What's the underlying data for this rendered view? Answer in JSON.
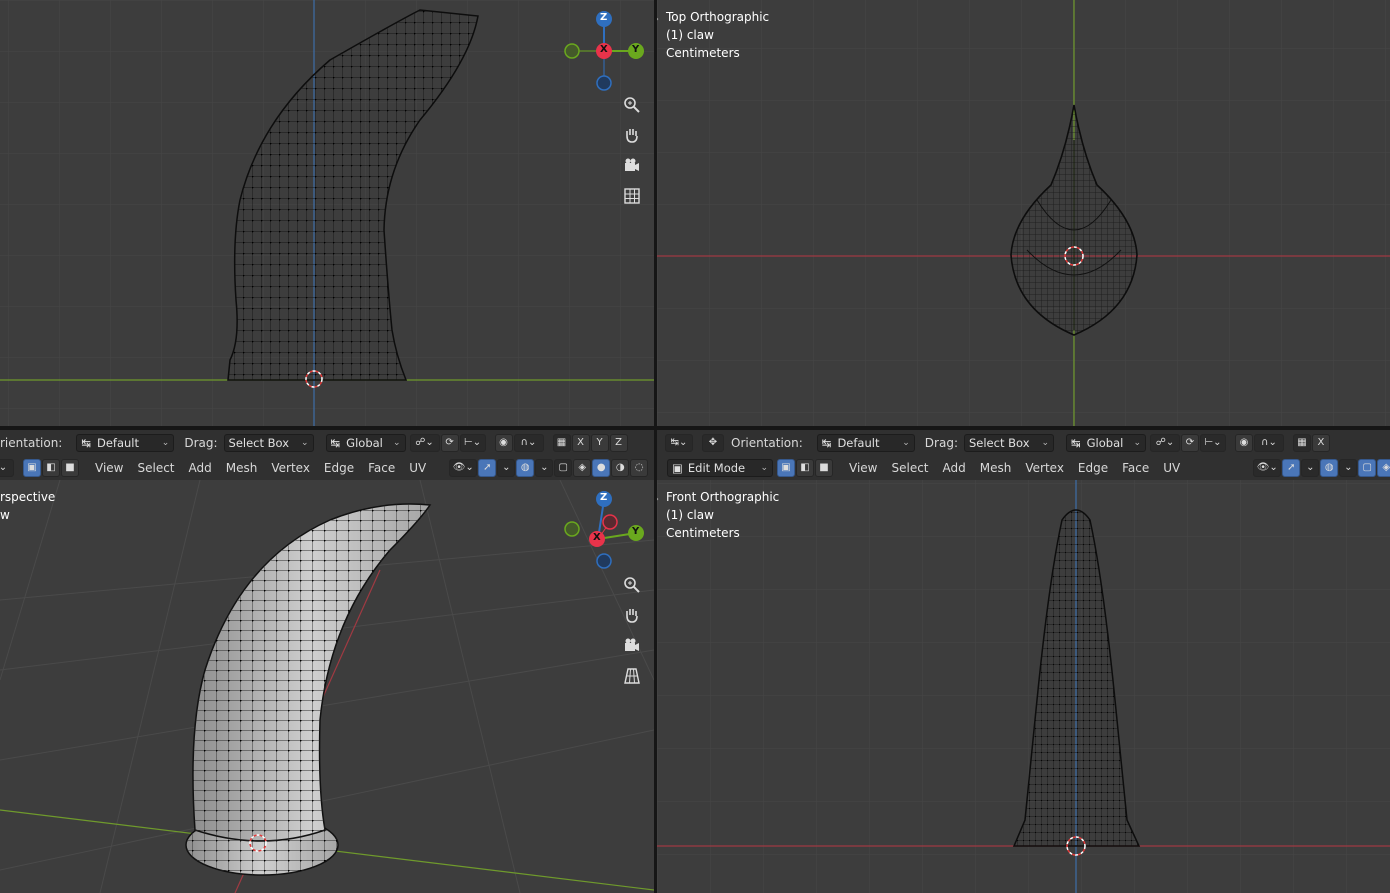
{
  "viewports": {
    "top_left": {
      "title": "",
      "object": "",
      "units": ""
    },
    "top_right": {
      "title": "Top Orthographic",
      "object": "(1) claw",
      "units": "Centimeters"
    },
    "bottom_left": {
      "title": "rspective",
      "object": "w",
      "units": ""
    },
    "bottom_right": {
      "title": "Front Orthographic",
      "object": "(1) claw",
      "units": "Centimeters"
    }
  },
  "gizmo_axes": {
    "x": "X",
    "y": "Y",
    "z": "Z"
  },
  "header_left": {
    "orientation_label": "rientation:",
    "orientation_value": "Default",
    "drag_label": "Drag:",
    "drag_value": "Select Box",
    "transform_value": "Global",
    "menus": [
      "View",
      "Select",
      "Add",
      "Mesh",
      "Vertex",
      "Edge",
      "Face",
      "UV"
    ],
    "axis_buttons": [
      "X",
      "Y",
      "Z"
    ]
  },
  "header_right": {
    "orientation_label": "Orientation:",
    "orientation_value": "Default",
    "drag_label": "Drag:",
    "drag_value": "Select Box",
    "transform_value": "Global",
    "mode_value": "Edit Mode",
    "menus": [
      "View",
      "Select",
      "Add",
      "Mesh",
      "Vertex",
      "Edge",
      "Face",
      "UV"
    ],
    "axis_buttons": [
      "X"
    ]
  },
  "icons": {
    "zoom": "zoom-icon",
    "pan": "hand-icon",
    "camera": "camera-icon",
    "ortho": "grid-icon",
    "persp": "perspective-grid-icon"
  },
  "colors": {
    "viewport_bg": "#3d3d3d",
    "header_bg": "#303030",
    "axis_x": "#ff3352",
    "axis_y": "#8bdc00",
    "axis_z": "#2890ff",
    "active_button": "#4a76b8",
    "red_line": "#a03a42",
    "green_line": "#6f9a2c",
    "blue_line": "#3e6fa8"
  }
}
